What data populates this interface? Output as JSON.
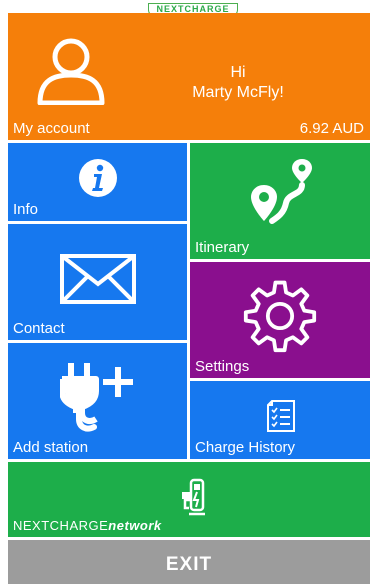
{
  "brand": {
    "logo_text": "NEXTCHARGE"
  },
  "account": {
    "greeting": "Hi",
    "user_name": "Marty McFly!",
    "label": "My account",
    "balance": "6.92 AUD"
  },
  "tiles": {
    "info": "Info",
    "itinerary": "Itinerary",
    "contact": "Contact",
    "settings": "Settings",
    "add_station": "Add station",
    "charge_history": "Charge History"
  },
  "network": {
    "name_prefix": "NEXTCHARGE",
    "name_suffix": "network"
  },
  "exit": {
    "label": "EXIT"
  },
  "colors": {
    "orange": "#f57f0a",
    "blue": "#1678ef",
    "green": "#1dae4a",
    "purple": "#8a0f8e",
    "grey": "#9c9c9c"
  }
}
